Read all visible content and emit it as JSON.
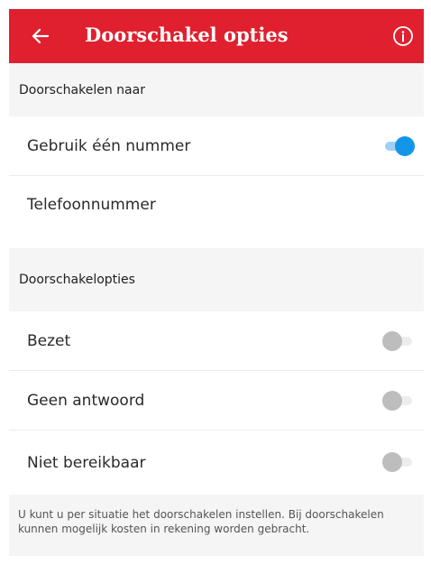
{
  "header": {
    "title": "Doorschakel opties",
    "back_icon": "arrow-left-icon",
    "info_icon": "info-circle-icon",
    "color": "#e0202e"
  },
  "section_forward_to": {
    "label": "Doorschakelen naar"
  },
  "use_one_number": {
    "label": "Gebruik één nummer",
    "enabled": true
  },
  "phone_number": {
    "label": "Telefoonnummer"
  },
  "section_options": {
    "label": "Doorschakelopties"
  },
  "options": [
    {
      "label": "Bezet",
      "enabled": false
    },
    {
      "label": "Geen antwoord",
      "enabled": false
    },
    {
      "label": "Niet bereikbaar",
      "enabled": false
    }
  ],
  "footer": {
    "text": "U kunt u per situatie het doorschakelen instellen. Bij doorschakelen kunnen mogelijk kosten in rekening worden gebracht."
  },
  "colors": {
    "toggle_on": "#1496e8",
    "toggle_off": "#bdbdbd"
  }
}
